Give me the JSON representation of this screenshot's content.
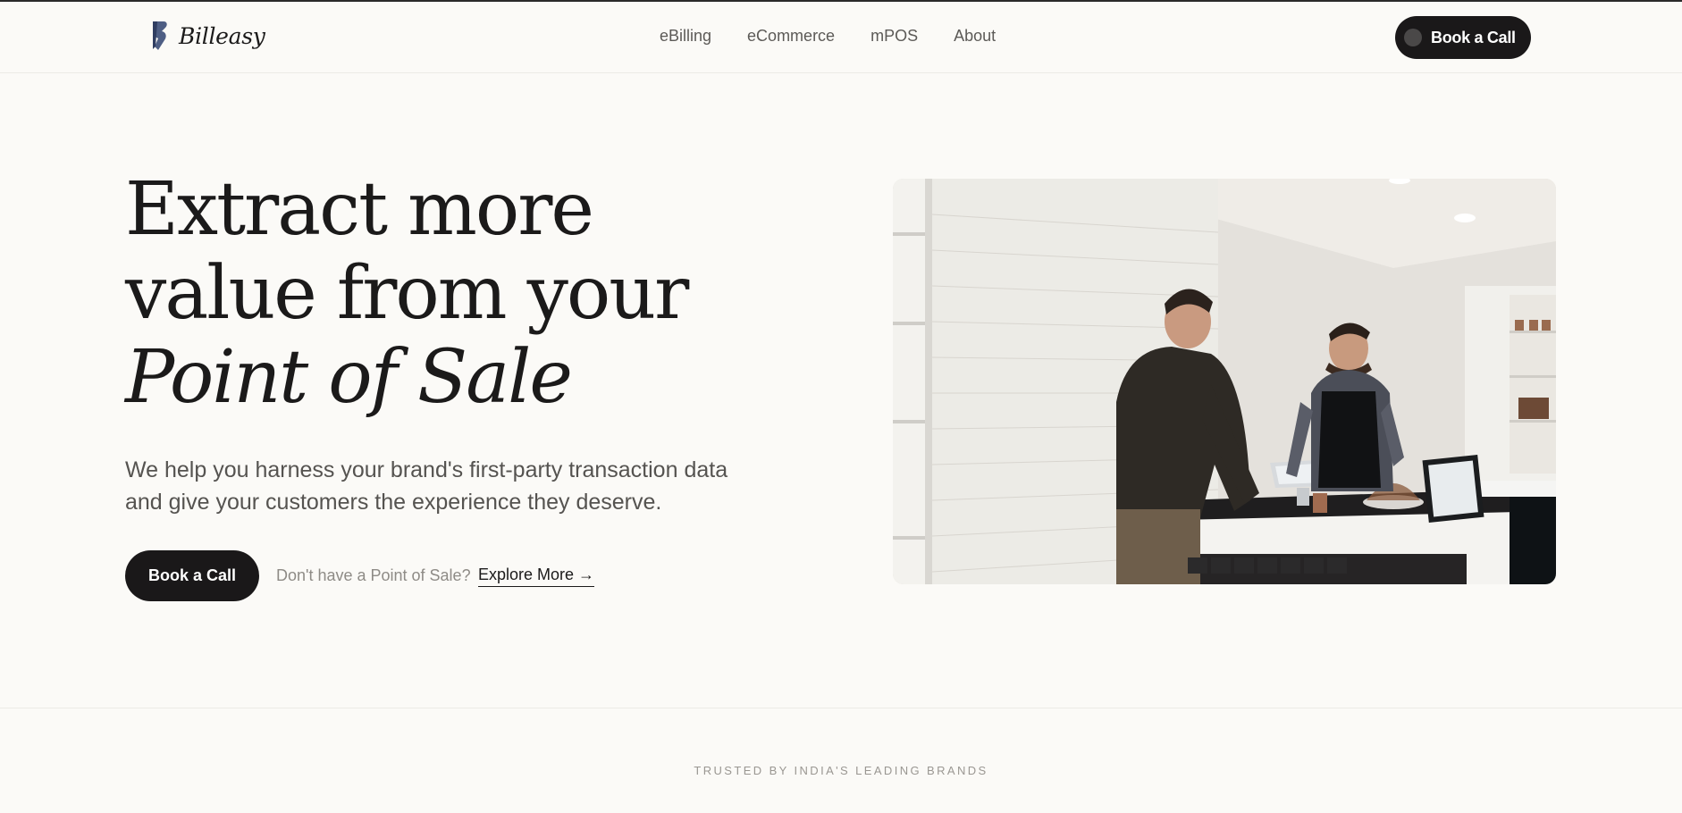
{
  "brand": {
    "name": "Billeasy",
    "accent": "#1a1819",
    "background": "#fbfaf7"
  },
  "nav": {
    "items": [
      {
        "label": "eBilling"
      },
      {
        "label": "eCommerce"
      },
      {
        "label": "mPOS"
      },
      {
        "label": "About"
      }
    ],
    "cta_label": "Book a Call"
  },
  "hero": {
    "title_line1": "Extract more",
    "title_line2": "value from your",
    "title_line3": "Point of Sale",
    "subtitle": "We help you harness your brand's first-party transaction data and give your customers the experience they deserve.",
    "primary_cta": "Book a Call",
    "prompt": "Don't have a Point of Sale?",
    "secondary_cta": "Explore More →",
    "image_icon": "retail-counter-photo"
  },
  "trusted": {
    "label": "TRUSTED BY INDIA'S LEADING BRANDS"
  }
}
